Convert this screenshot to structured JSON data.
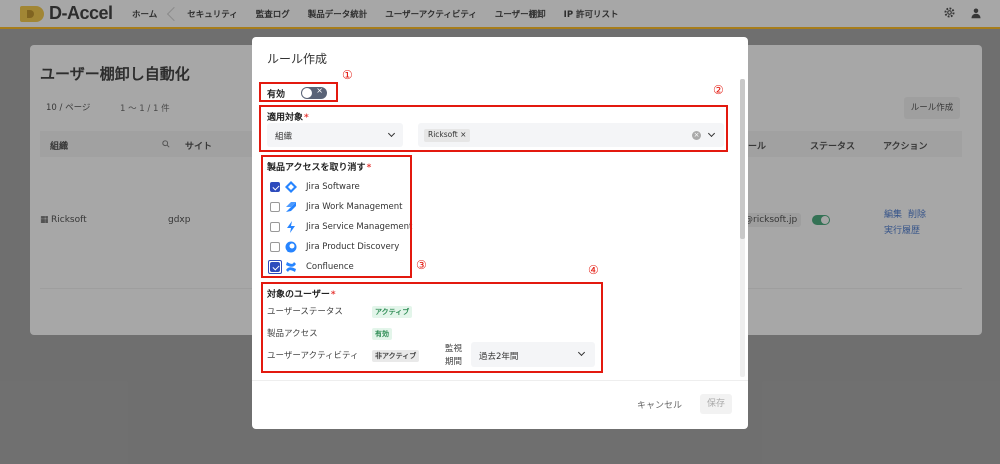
{
  "nav": {
    "logo": "D-Accel",
    "home": "ホーム",
    "items": [
      "セキュリティ",
      "監査ログ",
      "製品データ統計",
      "ユーザーアクティビティ",
      "ユーザー棚卸",
      "IP 許可リスト"
    ]
  },
  "background": {
    "title": "ユーザー棚卸し自動化",
    "per_page": "10 / ページ",
    "range": "1 〜 1 / 1 件",
    "rule_button": "ルール作成",
    "columns": {
      "org": "組織",
      "site": "サイト",
      "mail_col": "ール",
      "status": "ステータス",
      "action": "アクション"
    },
    "row": {
      "org": "Ricksoft",
      "site": "gdxp",
      "mail": "@ricksoft.jp",
      "edit": "編集",
      "delete": "削除",
      "history": "実行履歴"
    }
  },
  "modal": {
    "title": "ルール作成",
    "enabled_label": "有効",
    "toggle_glyph": "×",
    "target_label": "適用対象",
    "target_type": "組織",
    "target_tag": "Ricksoft",
    "tag_close": "×",
    "revoke_label": "製品アクセスを取り消す",
    "products": [
      {
        "name": "Jira Software",
        "checked": true,
        "icon": "jira-software-icon",
        "color": "#2684ff"
      },
      {
        "name": "Jira Work Management",
        "checked": false,
        "icon": "jira-work-management-icon",
        "color": "#2684ff"
      },
      {
        "name": "Jira Service Management",
        "checked": false,
        "icon": "jira-service-management-icon",
        "color": "#2684ff"
      },
      {
        "name": "Jira Product Discovery",
        "checked": false,
        "icon": "jira-product-discovery-icon",
        "color": "#2684ff"
      },
      {
        "name": "Confluence",
        "checked": true,
        "icon": "confluence-icon",
        "color": "#2684ff"
      }
    ],
    "target_users_label": "対象のユーザー",
    "user_status_label": "ユーザーステータス",
    "user_status_value": "アクティブ",
    "product_access_label": "製品アクセス",
    "product_access_value": "有効",
    "user_activity_label": "ユーザーアクティビティ",
    "user_activity_value": "非アクティブ",
    "period_label_1": "監視",
    "period_label_2": "期間",
    "period_value": "過去2年間",
    "cancel": "キャンセル",
    "save": "保存"
  },
  "annotations": {
    "n1": "①",
    "n2": "②",
    "n3": "③",
    "n4": "④",
    "color": "#e3190f"
  },
  "colors": {
    "accent": "#ffb300",
    "checkbox": "#2d4bbd",
    "toggle_off": "#596377"
  }
}
